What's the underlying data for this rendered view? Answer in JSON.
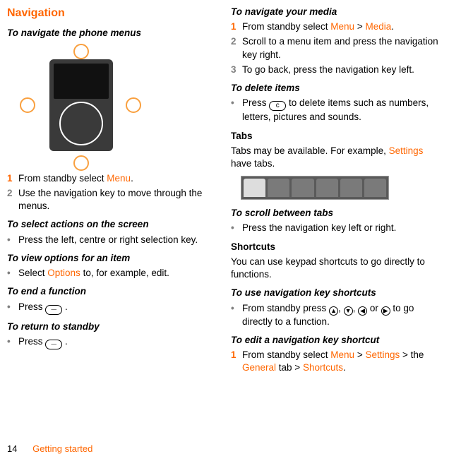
{
  "left": {
    "heading": "Navigation",
    "sub_navigate_phone": "To navigate the phone menus",
    "step1_pre": "From standby select ",
    "step1_menu": "Menu",
    "step1_post": ".",
    "step2": "Use the navigation key to move through the menus.",
    "sub_select_actions": "To select actions on the screen",
    "bullet_select_actions": "Press the left, centre or right selection key.",
    "sub_view_options": "To view options for an item",
    "bullet_view_options_pre": "Select ",
    "bullet_view_options_opt": "Options",
    "bullet_view_options_post": " to, for example, edit.",
    "sub_end_function": "To end a function",
    "bullet_end_function_pre": "Press ",
    "bullet_end_function_post": " .",
    "sub_return_standby": "To return to standby",
    "bullet_return_standby_pre": "Press ",
    "bullet_return_standby_post": " ."
  },
  "right": {
    "sub_navigate_media": "To navigate your media",
    "r_step1_pre": "From standby select ",
    "r_step1_menu": "Menu",
    "r_step1_gt": " > ",
    "r_step1_media": "Media",
    "r_step1_post": ".",
    "r_step2": "Scroll to a menu item and press the navigation key right.",
    "r_step3": "To go back, press the navigation key left.",
    "sub_delete_items": "To delete items",
    "bullet_delete_pre": "Press ",
    "bullet_delete_key": "c",
    "bullet_delete_post": " to delete items such as numbers, letters, pictures and sounds.",
    "tabs_heading": "Tabs",
    "tabs_body_pre": "Tabs may be available. For example, ",
    "tabs_body_settings": "Settings",
    "tabs_body_post": " have tabs.",
    "sub_scroll_tabs": "To scroll between tabs",
    "bullet_scroll_tabs": "Press the navigation key left or right.",
    "shortcuts_heading": "Shortcuts",
    "shortcuts_body": "You can use keypad shortcuts to go directly to functions.",
    "sub_use_navkey": "To use navigation key shortcuts",
    "bullet_use_navkey_pre": "From standby press ",
    "bullet_use_navkey_mid1": ", ",
    "bullet_use_navkey_mid2": ", ",
    "bullet_use_navkey_mid3": " or ",
    "bullet_use_navkey_post": " to go directly to a function.",
    "sub_edit_navkey": "To edit a navigation key shortcut",
    "edit_step1_pre": "From standby select ",
    "edit_step1_menu": "Menu",
    "edit_step1_gt1": " > ",
    "edit_step1_settings": "Settings",
    "edit_step1_gt2": " > the ",
    "edit_step1_general": "General",
    "edit_step1_mid": " tab > ",
    "edit_step1_shortcuts": "Shortcuts",
    "edit_step1_post": "."
  },
  "footer": {
    "page": "14",
    "section": "Getting started"
  },
  "numbers": {
    "n1": "1",
    "n2": "2",
    "n3": "3"
  },
  "bullet_glyph": "•"
}
